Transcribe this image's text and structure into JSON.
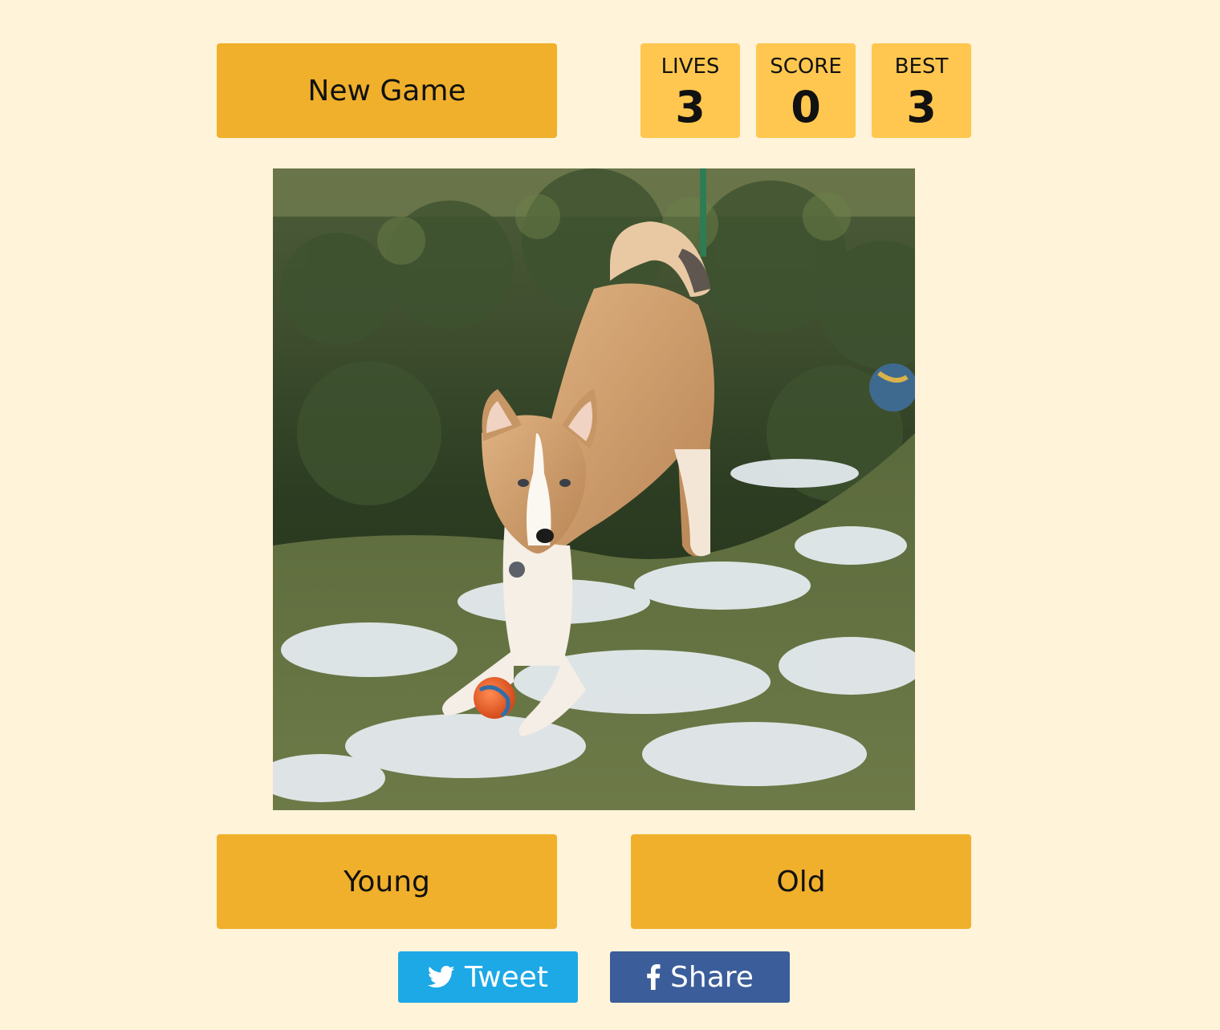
{
  "header": {
    "new_game_label": "New Game"
  },
  "stats": {
    "lives_label": "LIVES",
    "lives_value": "3",
    "score_label": "SCORE",
    "score_value": "0",
    "best_label": "BEST",
    "best_value": "3"
  },
  "answers": {
    "young_label": "Young",
    "old_label": "Old"
  },
  "social": {
    "tweet_label": "Tweet",
    "tweet_icon": "twitter-bird-icon",
    "share_label": "Share",
    "share_icon": "facebook-f-icon"
  },
  "colors": {
    "background": "#fff3d9",
    "button": "#f0b02b",
    "stat_box": "#ffc74f",
    "twitter": "#1da8e6",
    "facebook": "#3b5d9a"
  }
}
